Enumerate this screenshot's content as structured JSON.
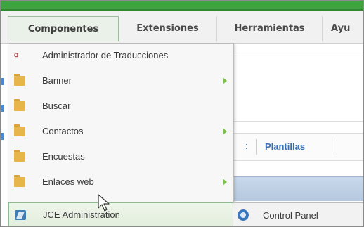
{
  "menubar": {
    "items": [
      {
        "label": "Componentes",
        "active": true
      },
      {
        "label": "Extensiones",
        "active": false
      },
      {
        "label": "Herramientas",
        "active": false
      },
      {
        "label": "Ayu",
        "active": false
      }
    ]
  },
  "dropdown": {
    "items": [
      {
        "label": "Administrador de Traducciones",
        "icon": "translation-icon",
        "has_submenu": false
      },
      {
        "label": "Banner",
        "icon": "folder-icon",
        "has_submenu": true
      },
      {
        "label": "Buscar",
        "icon": "folder-icon",
        "has_submenu": false
      },
      {
        "label": "Contactos",
        "icon": "folder-icon",
        "has_submenu": true
      },
      {
        "label": "Encuestas",
        "icon": "folder-icon",
        "has_submenu": false
      },
      {
        "label": "Enlaces web",
        "icon": "folder-icon",
        "has_submenu": true
      },
      {
        "label": "JCE Administration",
        "icon": "jce-icon",
        "has_submenu": false,
        "highlighted": true
      }
    ]
  },
  "background": {
    "tab_separator": ":",
    "tab_label": "Plantillas"
  },
  "submenu": {
    "items": [
      {
        "label": "Control Panel",
        "icon": "control-panel-icon"
      }
    ]
  }
}
